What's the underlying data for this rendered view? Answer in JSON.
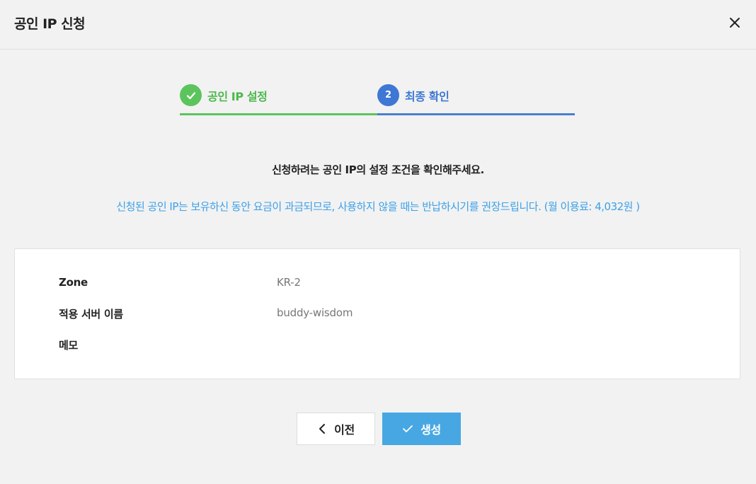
{
  "dialog": {
    "title": "공인 IP 신청"
  },
  "steps": [
    {
      "number": "1",
      "label": "공인 IP 설정",
      "status": "completed",
      "color": "#5cc45c"
    },
    {
      "number": "2",
      "label": "최종 확인",
      "status": "active",
      "color": "#3e78d4"
    }
  ],
  "confirm": {
    "heading": "신청하려는 공인 IP의 설정 조건을 확인해주세요.",
    "notice": "신청된 공인 IP는 보유하신 동안 요금이 과금되므로, 사용하지 않을 때는 반납하시기를 권장드립니다. (월 이용료: 4,032원 )",
    "notice_color": "#3ba0e8"
  },
  "details": [
    {
      "label": "Zone",
      "value": "KR-2"
    },
    {
      "label": "적용 서버 이름",
      "value": "buddy-wisdom"
    },
    {
      "label": "메모",
      "value": ""
    }
  ],
  "buttons": {
    "prev_label": "이전",
    "create_label": "생성",
    "create_color": "#47a7e3"
  },
  "icons": {
    "close": "close-icon",
    "step_complete": "check-icon",
    "prev": "chevron-left-icon",
    "create": "check-icon"
  }
}
